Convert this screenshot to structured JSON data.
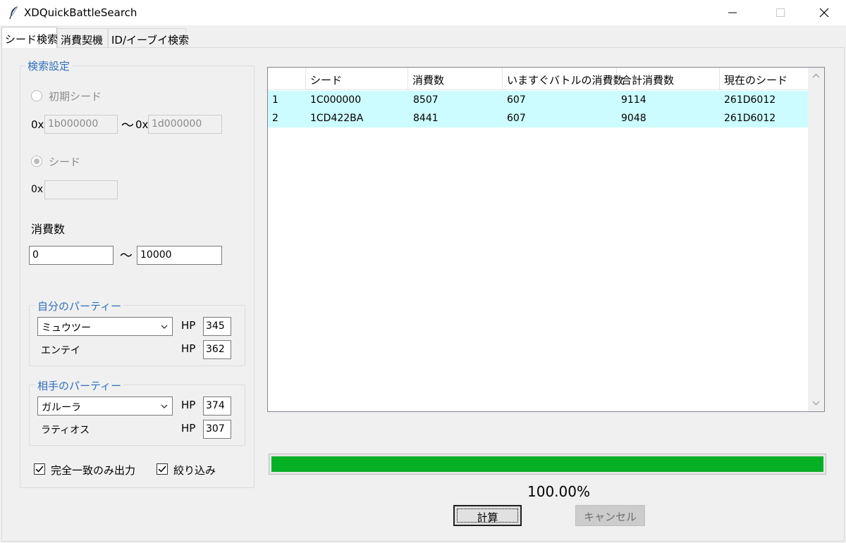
{
  "window": {
    "title": "XDQuickBattleSearch",
    "icon": "feather-icon"
  },
  "tabs": [
    {
      "label": "シード検索",
      "selected": true
    },
    {
      "label": "消費契機",
      "selected": false
    },
    {
      "label": "ID/イーブイ検索",
      "selected": false
    }
  ],
  "settings": {
    "group_title": "検索設定",
    "initial_seed": {
      "label": "初期シード",
      "selected": false,
      "prefix_from": "0x",
      "from": "1b000000",
      "tilde": "〜",
      "prefix_to": "0x",
      "to": "1d000000"
    },
    "seed": {
      "label": "シード",
      "selected": true,
      "prefix": "0x",
      "value": ""
    },
    "consumption": {
      "label": "消費数",
      "from": "0",
      "tilde": "〜",
      "to": "10000"
    },
    "my_party": {
      "title": "自分のパーティー",
      "hp_label": "HP",
      "pokemon1": "ミュウツー",
      "hp1": "345",
      "pokemon2": "エンテイ",
      "hp2": "362"
    },
    "opponent_party": {
      "title": "相手のパーティー",
      "hp_label": "HP",
      "pokemon1": "ガルーラ",
      "hp1": "374",
      "pokemon2": "ラティオス",
      "hp2": "307"
    },
    "exact_match": {
      "label": "完全一致のみ出力",
      "checked": true
    },
    "filter": {
      "label": "絞り込み",
      "checked": true
    }
  },
  "results": {
    "columns": [
      "",
      "シード",
      "消費数",
      "いますぐバトルの消費数",
      "合計消費数",
      "現在のシード"
    ],
    "rows": [
      [
        "1",
        "1C000000",
        "8507",
        "607",
        "9114",
        "261D6012"
      ],
      [
        "2",
        "1CD422BA",
        "8441",
        "607",
        "9048",
        "261D6012"
      ]
    ],
    "highlight_color": "#ccfcff"
  },
  "progress": {
    "fraction": 1.0,
    "text": "100.00%",
    "color": "#06b025"
  },
  "buttons": {
    "calc": "計算",
    "cancel": "キャンセル"
  }
}
